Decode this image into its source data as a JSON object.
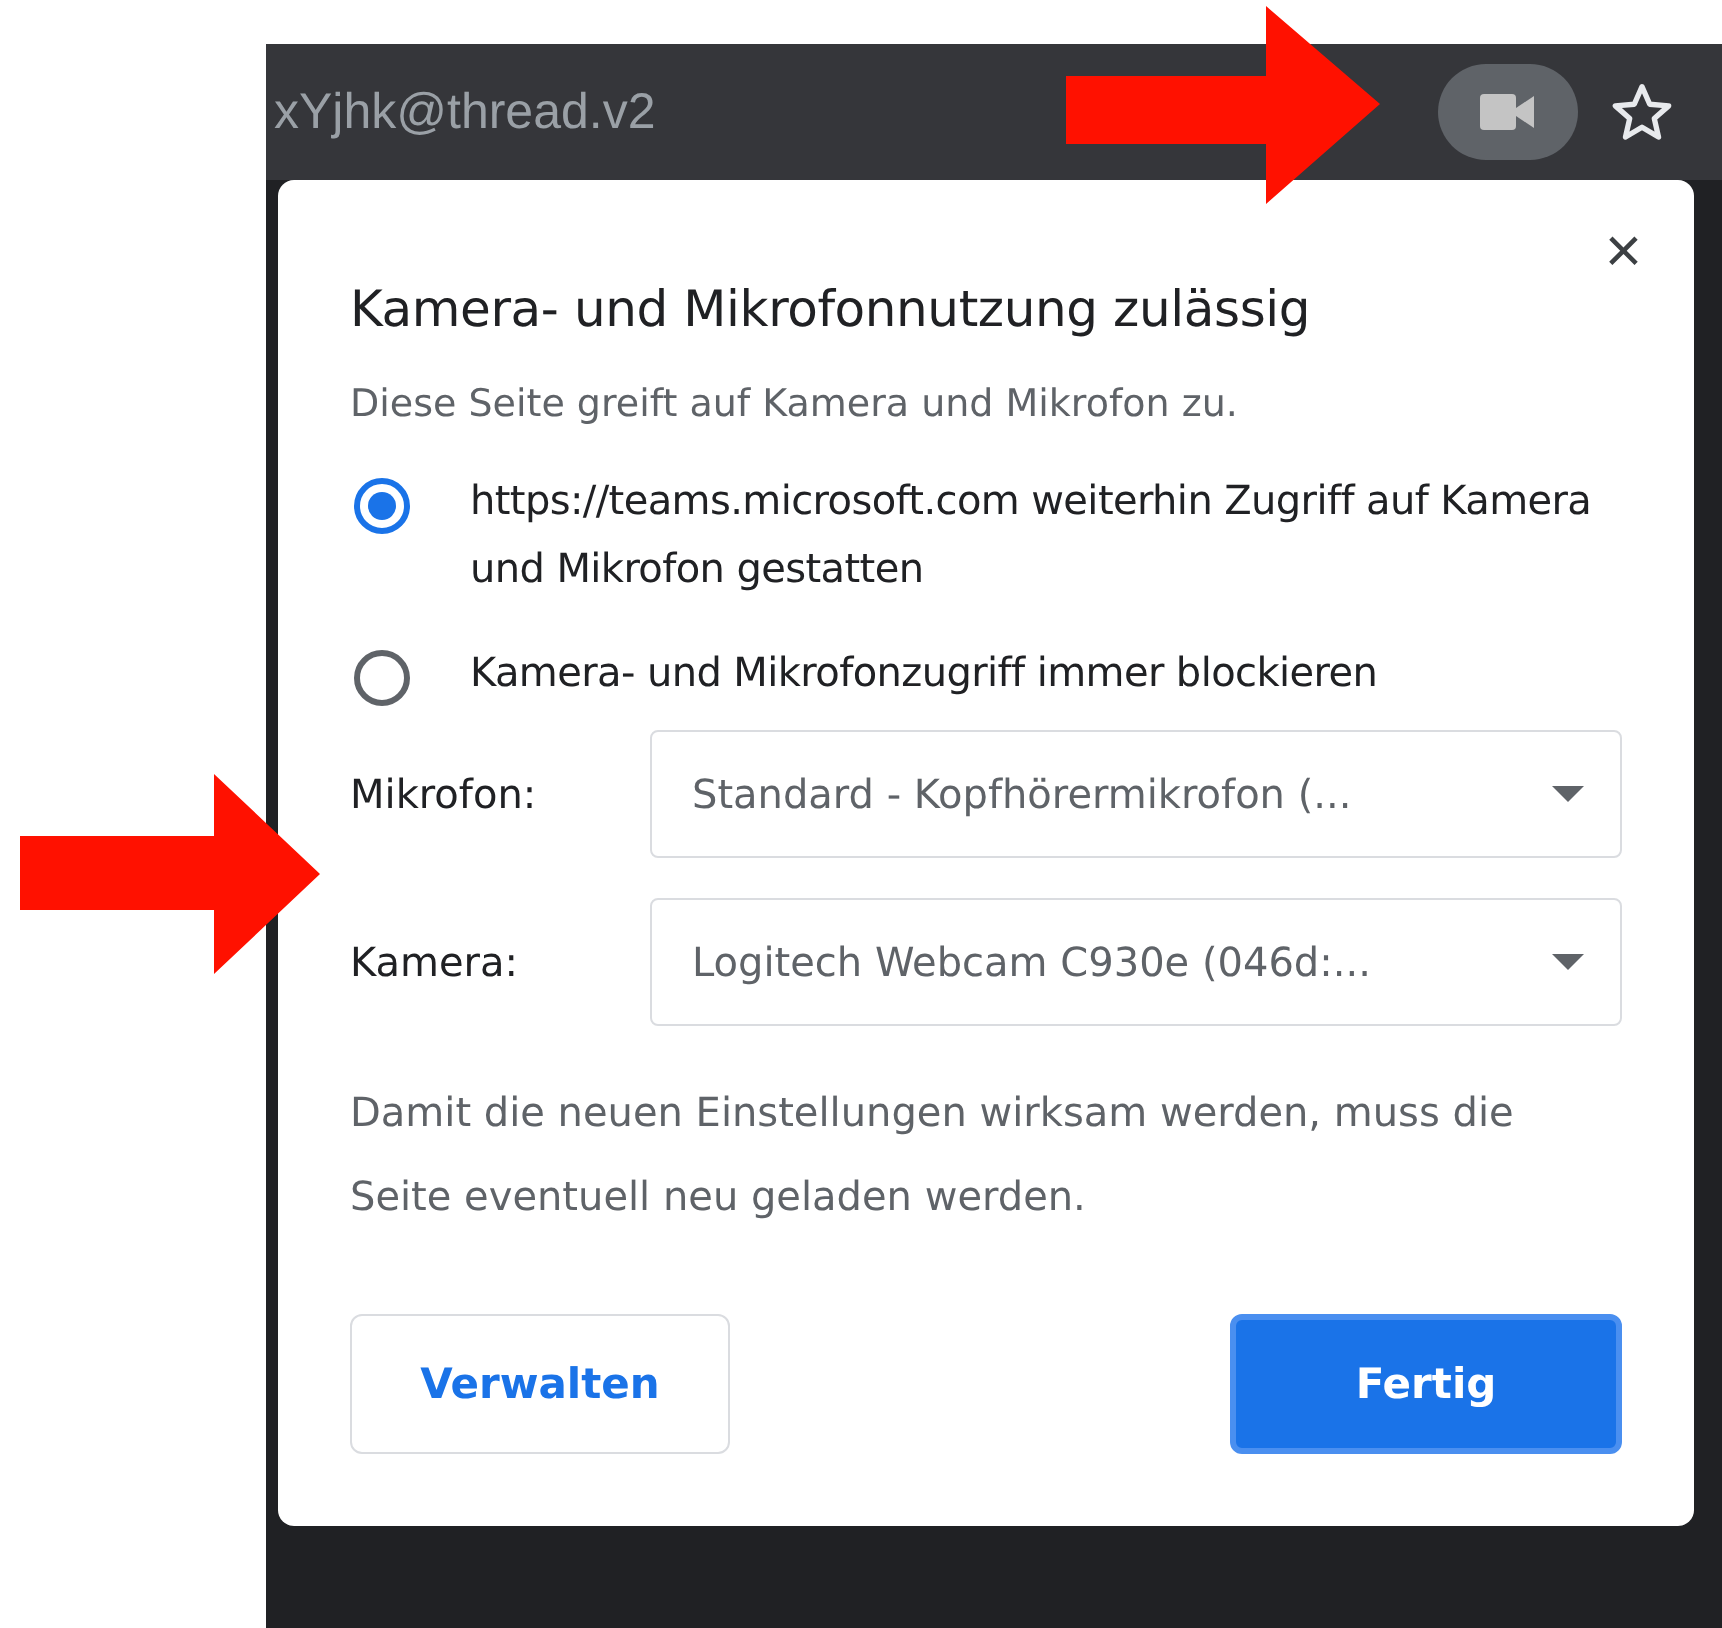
{
  "toolbar": {
    "url": "xYjhk@thread.v2",
    "camera_active": true
  },
  "dialog": {
    "close": "×",
    "title": "Kamera- und Mikrofonnutzung zulässig",
    "subtitle": "Diese Seite greift auf Kamera und Mikrofon zu.",
    "options": [
      {
        "label": "https://teams.microsoft.com weiterhin Zugriff auf Kamera und Mikrofon gestatten",
        "selected": true
      },
      {
        "label": "Kamera- und Mikrofonzugriff immer blockieren",
        "selected": false
      }
    ],
    "devices": [
      {
        "label": "Mikrofon:",
        "value": "Standard - Kopfhörermikrofon (..."
      },
      {
        "label": "Kamera:",
        "value": "Logitech Webcam C930e (046d:..."
      }
    ],
    "note": "Damit die neuen Einstellungen wirksam werden, muss die Seite eventuell neu geladen werden.",
    "buttons": [
      {
        "label": "Verwalten",
        "kind": "secondary"
      },
      {
        "label": "Fertig",
        "kind": "primary"
      }
    ]
  }
}
